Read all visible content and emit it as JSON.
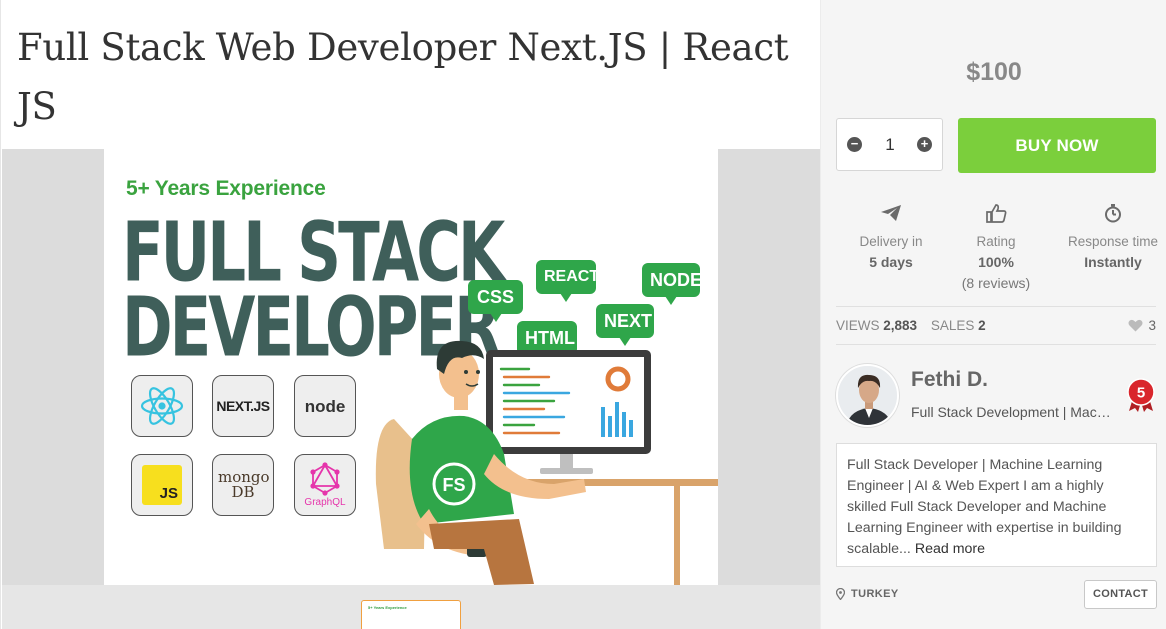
{
  "gig": {
    "title": "Full Stack Web Developer Next.JS | React JS"
  },
  "artwork": {
    "experience": "5+ Years Experience",
    "line1": "FULL STACK",
    "line2": "DEVELOPER",
    "tech_logos": [
      {
        "name": "react-logo",
        "label": ""
      },
      {
        "name": "nextjs-logo",
        "label": "NEXT.JS"
      },
      {
        "name": "nodejs-logo",
        "label": "node"
      },
      {
        "name": "javascript-logo",
        "label": "JS"
      },
      {
        "name": "mongodb-logo",
        "label": "mongo DB"
      },
      {
        "name": "graphql-logo",
        "label": "GraphQL"
      }
    ],
    "bubbles": {
      "css": "CSS",
      "react": "REACT",
      "node": "NODE",
      "html": "HTML",
      "next": "NEXT"
    },
    "shirt_text": "FS",
    "thumb_text": "5+ Years Experience"
  },
  "purchase": {
    "price": "$100",
    "quantity": "1",
    "buy_label": "BUY NOW"
  },
  "stats": {
    "delivery_label": "Delivery in",
    "delivery_value": "5 days",
    "rating_label": "Rating",
    "rating_value": "100%",
    "rating_reviews": "(8 reviews)",
    "response_label": "Response time",
    "response_value": "Instantly"
  },
  "meta": {
    "views_label": "VIEWS",
    "views_value": "2,883",
    "sales_label": "SALES",
    "sales_value": "2",
    "likes": "3"
  },
  "seller": {
    "name": "Fethi D.",
    "tagline": "Full Stack Development | Machine Learning",
    "level": "5",
    "bio": "Full Stack Developer | Machine Learning Engineer | AI & Web Expert I am a highly skilled Full Stack Developer and Machine Learning Engineer with expertise in building scalable...",
    "read_more": "Read more",
    "country": "TURKEY",
    "contact_label": "CONTACT"
  },
  "colors": {
    "buy_button": "#7bcf3c",
    "accent_green": "#2fa64a",
    "badge_red": "#d9262c"
  },
  "icons": {
    "delivery": "paper-plane-icon",
    "rating": "thumbs-up-icon",
    "response": "stopwatch-icon",
    "likes": "heart-icon",
    "location": "map-pin-icon"
  }
}
